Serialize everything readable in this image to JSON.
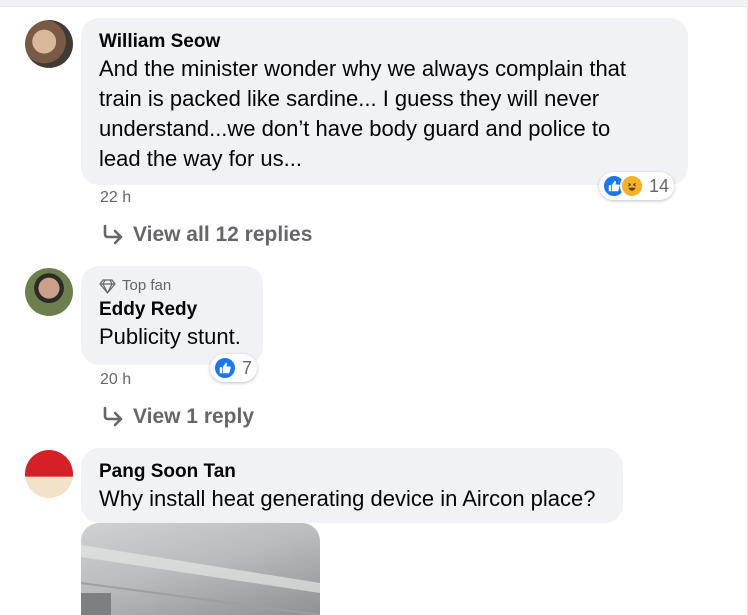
{
  "comments": [
    {
      "author": "William Seow",
      "text_lines": [
        "And the minister wonder why we always complain that",
        "train is packed like sardine... I guess they will never",
        "understand...we don’t have body guard and police to",
        "lead the way for us..."
      ],
      "time": "22 h",
      "reactions": {
        "types": [
          "like-icon",
          "haha-icon"
        ],
        "count": "14"
      },
      "replies_label": "View all 12 replies"
    },
    {
      "badge": "Top fan",
      "author": "Eddy Redy",
      "text": "Publicity stunt.",
      "time": "20 h",
      "reactions": {
        "types": [
          "like-icon"
        ],
        "count": "7"
      },
      "replies_label": "View 1 reply"
    },
    {
      "author": "Pang Soon Tan",
      "text": "Why install heat generating device in Aircon place?"
    }
  ],
  "colors": {
    "bubble": "#f0f2f5",
    "meta": "#65676b",
    "like": "#1877f2",
    "haha": "#f7b125"
  }
}
